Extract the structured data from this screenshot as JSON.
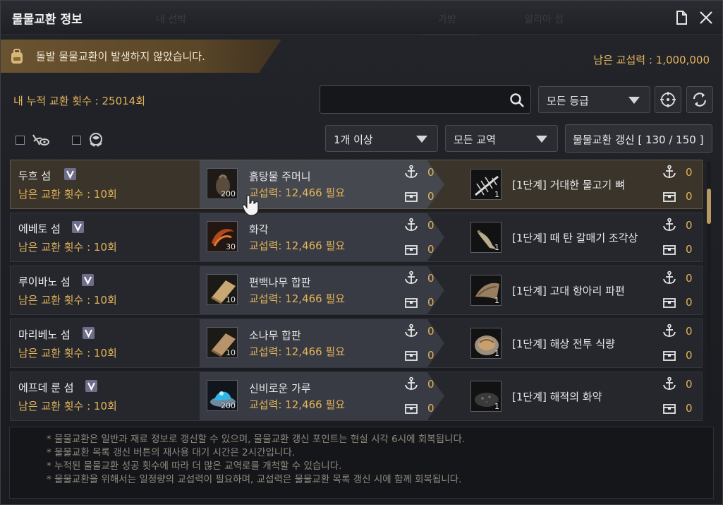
{
  "window": {
    "title": "물물교환 정보",
    "ghost_tabs": [
      "내 선박",
      "가방",
      "일리아 섬"
    ]
  },
  "alert": {
    "text": "돌발 물물교환이 발생하지 않았습니다."
  },
  "power": {
    "text": "남은 교섭력 : 1,000,000"
  },
  "exchanges": {
    "text": "내 누적 교환 횟수 : 25014회"
  },
  "search": {
    "value": "",
    "placeholder": ""
  },
  "filters": {
    "grade": "모든 등급",
    "amount": "1개 이상",
    "route": "모든 교역",
    "refresh_label": "물물교환 갱신 [ 130 / 150 ]"
  },
  "rows": [
    {
      "island": "두흐 섬",
      "remain": "남은 교환 횟수 : 10회",
      "item": "흙탕물 주머니",
      "item_qty": "200",
      "cost": "교섭력: 12,466 필요",
      "anchor": "0",
      "chest": "0",
      "reward": "[1단계] 거대한 물고기 뼈",
      "reward_qty": "1",
      "r_anchor": "0",
      "r_chest": "0"
    },
    {
      "island": "에베토 섬",
      "remain": "남은 교환 횟수 : 10회",
      "item": "화각",
      "item_qty": "30",
      "cost": "교섭력: 12,466 필요",
      "anchor": "0",
      "chest": "0",
      "reward": "[1단계] 때 탄 갈매기 조각상",
      "reward_qty": "1",
      "r_anchor": "0",
      "r_chest": "0"
    },
    {
      "island": "루이바노 섬",
      "remain": "남은 교환 횟수 : 10회",
      "item": "편백나무 합판",
      "item_qty": "10",
      "cost": "교섭력: 12,466 필요",
      "anchor": "0",
      "chest": "0",
      "reward": "[1단계] 고대 항아리 파편",
      "reward_qty": "1",
      "r_anchor": "0",
      "r_chest": "0"
    },
    {
      "island": "마리베노 섬",
      "remain": "남은 교환 횟수 : 10회",
      "item": "소나무 합판",
      "item_qty": "10",
      "cost": "교섭력: 12,466 필요",
      "anchor": "0",
      "chest": "0",
      "reward": "[1단계] 해상 전투 식량",
      "reward_qty": "1",
      "r_anchor": "0",
      "r_chest": "0"
    },
    {
      "island": "에프데 룬 섬",
      "remain": "남은 교환 횟수 : 10회",
      "item": "신비로운 가루",
      "item_qty": "200",
      "cost": "교섭력: 12,466 필요",
      "anchor": "0",
      "chest": "0",
      "reward": "[1단계] 해적의 화약",
      "reward_qty": "1",
      "r_anchor": "0",
      "r_chest": "0"
    }
  ],
  "notes": [
    "* 물물교환은 일반과 재료 정보로 갱신할 수 있으며, 물물교환 갱신 포인트는 현실 시각 6시에 회복됩니다.",
    "* 물물교환 목록 갱신 버튼의 재사용 대기 시간은 2시간입니다.",
    "* 누적된 물물교환 성공 횟수에 따라 더 많은 교역로를 개척할 수 있습니다.",
    "* 물물교환을 위해서는 일정량의 교섭력이 필요하며, 교섭력은 물물교환 목록 갱신 시에 함께 회복됩니다."
  ],
  "icons": {
    "anchor": "anchor-icon",
    "chest": "chest-icon",
    "verify": "v-badge-icon"
  },
  "colors": {
    "accent_gold": "#e4b45a",
    "alert_bg": "#6a5330"
  }
}
